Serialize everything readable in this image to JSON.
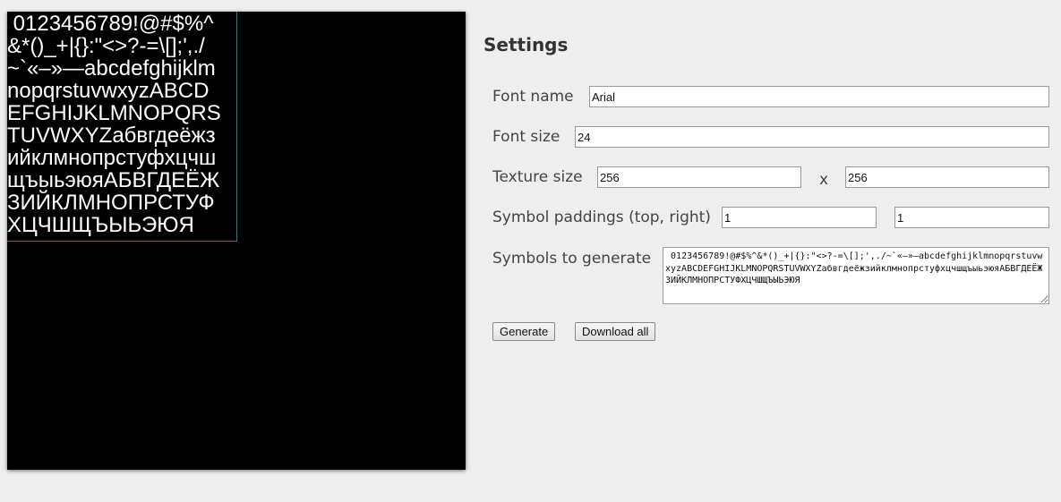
{
  "texture_lines": [
    " 0123456789!@#$%^",
    "&*()_+|{}:\"<>?-=\\[];',./",
    "~`«–»—abcdefghijklm",
    "nopqrstuvwxyzABCD",
    "EFGHIJKLMNOPQRS",
    "TUVWXYZабвгдеёжз",
    "ийклмнопрстуфхцчш",
    "щъыьэюяАБВГДЕЁЖ",
    "ЗИЙКЛМНОПРСТУФ",
    "ХЦЧШЩЪЫЬЭЮЯ"
  ],
  "settings": {
    "title": "Settings",
    "font_name_label": "Font name",
    "font_name_value": "Arial",
    "font_size_label": "Font size",
    "font_size_value": "24",
    "texture_size_label": "Texture size",
    "texture_width": "256",
    "texture_separator": "x",
    "texture_height": "256",
    "paddings_label": "Symbol paddings (top, right)",
    "padding_top": "1",
    "padding_right": "1",
    "symbols_label": "Symbols to generate",
    "symbols_value": " 0123456789!@#$%^&*()_+|{}:\"<>?-=\\[];',./~`«–»—abcdefghijklmnopqrstuvwxyzABCDEFGHIJKLMNOPQRSTUVWXYZабвгдеёжзийклмнопрстуфхцчшщъыьэюяАБВГДЕЁЖЗИЙКЛМНОПРСТУФХЦЧШЩЪЫЬЭЮЯ"
  },
  "buttons": {
    "generate": "Generate",
    "download_all": "Download all"
  }
}
